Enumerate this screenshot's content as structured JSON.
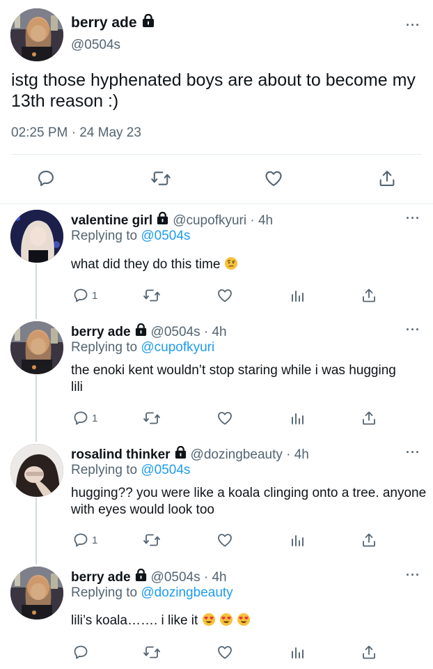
{
  "main_tweet": {
    "name": "berry ade",
    "handle": "@0504s",
    "text": "istg those hyphenated boys are about to become my 13th reason :)",
    "timestamp": "02:25 PM · 24 May 23",
    "more": "···",
    "icons": [
      "reply-icon",
      "retweet-icon",
      "like-icon",
      "share-icon"
    ]
  },
  "replies": [
    {
      "name": "valentine girl",
      "meta": "@cupofkyuri · 4h",
      "replying_prefix": "Replying to ",
      "replying_to": "@0504s",
      "text": "what did they do this time",
      "emoji": "face-with-raised-eyebrow",
      "reply_count": "1",
      "more": "···"
    },
    {
      "name": "berry ade",
      "meta": "@0504s · 4h",
      "replying_prefix": "Replying to ",
      "replying_to": "@cupofkyuri",
      "text": "the enoki kent wouldn’t stop staring while i was hugging lili",
      "reply_count": "1",
      "more": "···"
    },
    {
      "name": "rosalind thinker",
      "meta": "@dozingbeauty · 4h",
      "replying_prefix": "Replying to ",
      "replying_to": "@0504s",
      "text": "hugging?? you were like a koala clinging onto a tree. anyone with eyes would look too",
      "reply_count": "1",
      "more": "···"
    },
    {
      "name": "berry ade",
      "meta": "@0504s · 4h",
      "replying_prefix": "Replying to ",
      "replying_to": "@dozingbeauty",
      "text": "lili’s koala……. i like it",
      "emoji": "heart-eyes x3",
      "reply_count": "",
      "more": "···"
    }
  ],
  "colors": {
    "text": "#0f1419",
    "secondary": "#536471",
    "link": "#1d9bf0",
    "divider": "#e6ecf0"
  }
}
